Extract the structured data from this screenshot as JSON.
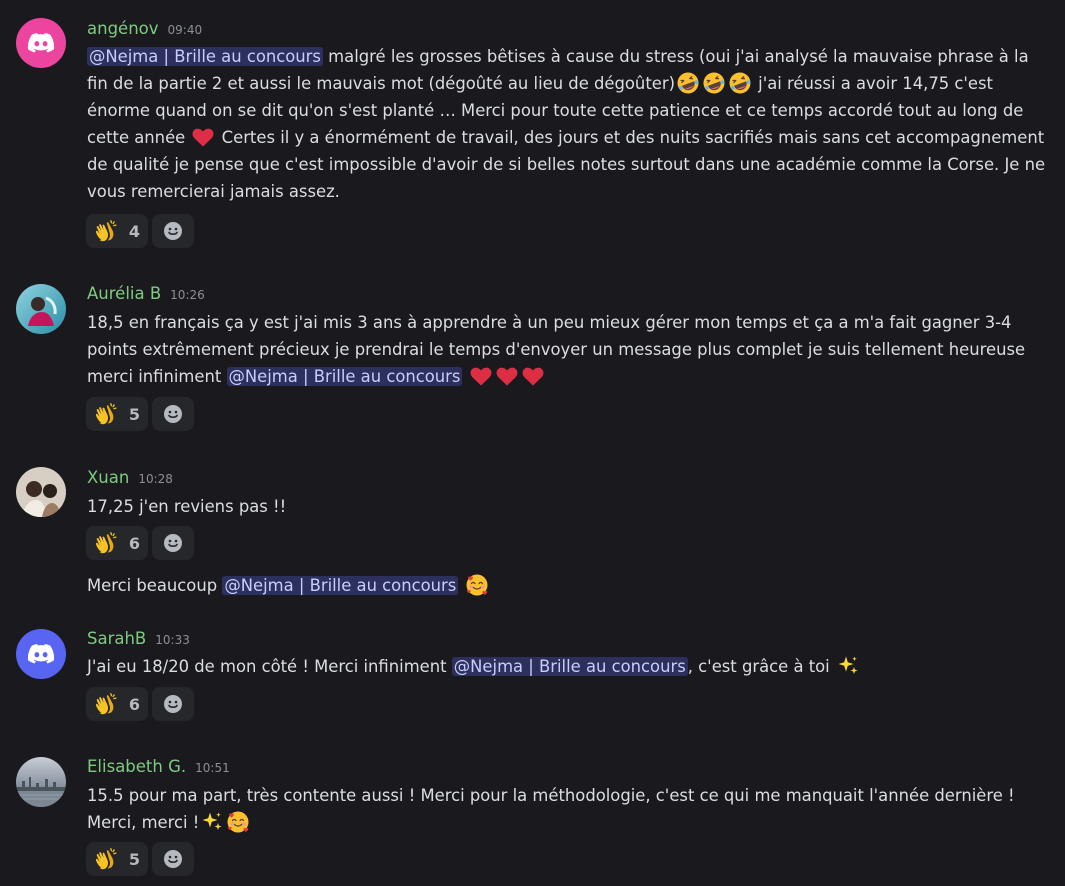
{
  "messages": [
    {
      "author": "angénov",
      "time": "09:40",
      "segments": {
        "mention": "@Nejma | Brille au concours",
        "t1": "  malgré les grosses bêtises à cause du stress (oui j'ai analysé la mauvaise phrase à la fin de la partie 2 et aussi le mauvais mot (dégoûté au lieu de dégoûter)",
        "t2": " j'ai réussi a avoir 14,75 c'est énorme quand on se dit qu'on s'est planté … Merci pour toute cette patience et ce temps accordé tout au long de cette année ",
        "t3": " Certes il y a énormément de travail, des jours et des nuits sacrifiés mais sans cet accompagnement de qualité je pense que c'est impossible d'avoir de si belles notes surtout dans une académie comme la Corse. Je ne vous remercierai jamais assez."
      },
      "reaction_count": "4"
    },
    {
      "author": "Aurélia B",
      "time": "10:26",
      "segments": {
        "t1": "18,5 en français ça y est j'ai mis 3 ans à apprendre à un peu mieux gérer mon temps et ça a m'a fait gagner 3-4 points extrêmement précieux je prendrai le temps d'envoyer un message plus complet je suis tellement heureuse merci infiniment ",
        "mention": "@Nejma | Brille au concours",
        "t2": "  "
      },
      "reaction_count": "5"
    },
    {
      "author": "Xuan",
      "time": "10:28",
      "segments": {
        "t1": "17,25 j'en reviens pas !!"
      },
      "reaction_count": "6",
      "followup": {
        "t1": "Merci beaucoup ",
        "mention": "@Nejma | Brille au concours",
        "t2": " "
      }
    },
    {
      "author": "SarahB",
      "time": "10:33",
      "segments": {
        "t1": "J'ai eu 18/20 de mon côté ! Merci infiniment ",
        "mention": "@Nejma | Brille au concours",
        "t2": ", c'est grâce à toi "
      },
      "reaction_count": "6"
    },
    {
      "author": "Elisabeth G.",
      "time": "10:51",
      "segments": {
        "t1": "15.5 pour ma part, très contente aussi ! Merci pour la méthodologie, c'est ce qui me manquait l'année dernière ! Merci, merci !"
      },
      "reaction_count": "5"
    }
  ],
  "colors": {
    "background": "#1a1a1e",
    "author_name": "#7ecb80",
    "mention_text": "#c9cdfb",
    "discord_pink": "#eb459f",
    "discord_blurple": "#5865f2"
  },
  "icons": {
    "reaction_emoji": "clapping-hands-emoji",
    "add_reaction": "smiley-add-reaction-icon"
  }
}
